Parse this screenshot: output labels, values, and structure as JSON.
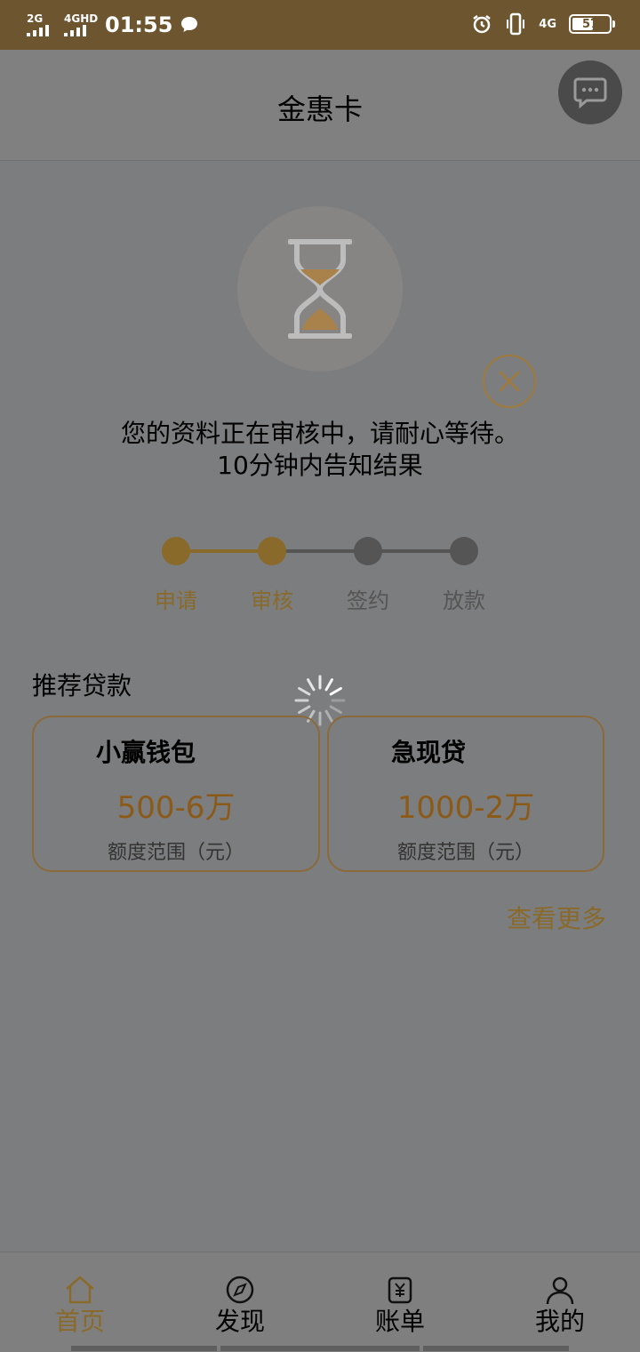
{
  "status_bar": {
    "sim1": "2G",
    "sim2": "4GHD",
    "time": "01:55",
    "net_right": "4G",
    "battery": "57"
  },
  "header": {
    "title": "金惠卡"
  },
  "review": {
    "line1": "您的资料正在审核中，请耐心等待。",
    "line2": "10分钟内告知结果"
  },
  "steps": [
    {
      "label": "申请",
      "done": true
    },
    {
      "label": "审核",
      "done": true
    },
    {
      "label": "签约",
      "done": false
    },
    {
      "label": "放款",
      "done": false
    }
  ],
  "recommend": {
    "title": "推荐贷款",
    "cards": [
      {
        "name": "小赢钱包",
        "amount": "500-6万",
        "sub": "额度范围（元）"
      },
      {
        "name": "急现贷",
        "amount": "1000-2万",
        "sub": "额度范围（元）"
      }
    ],
    "more": "查看更多"
  },
  "tabs": [
    {
      "label": "首页",
      "icon": "home-icon",
      "active": true
    },
    {
      "label": "发现",
      "icon": "compass-icon",
      "active": false
    },
    {
      "label": "账单",
      "icon": "bill-icon",
      "active": false
    },
    {
      "label": "我的",
      "icon": "user-icon",
      "active": false
    }
  ],
  "colors": {
    "accent": "#8a6a2a",
    "status_bar": "#6d5530",
    "inactive_step": "#555555"
  }
}
